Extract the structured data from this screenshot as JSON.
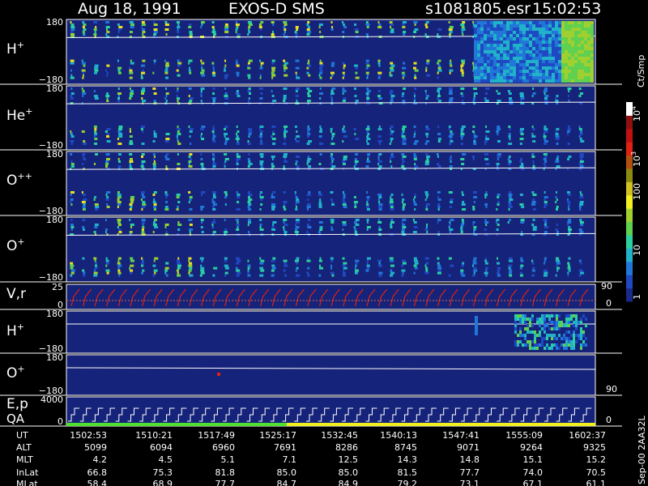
{
  "header": {
    "date": "Aug 18, 1991",
    "instrument": "EXOS-D SMS",
    "file": "s1081805.esr",
    "time": "15:02:53"
  },
  "colorbar": {
    "unit_label": "Ct/Smp",
    "tick_labels": [
      "1",
      "10",
      "100",
      "10",
      "3",
      "10",
      "4"
    ],
    "colors": [
      "#1a2a8a",
      "#1f49c2",
      "#2077d8",
      "#20b2c8",
      "#2ad0a0",
      "#5fd050",
      "#a0d030",
      "#f0f020",
      "#d0c020",
      "#8a8a10",
      "#b05010",
      "#e02010",
      "#c01010",
      "#901010",
      "#ffffff"
    ]
  },
  "panels": [
    {
      "id": "hplus",
      "label": "H",
      "sup": "+",
      "ymax": "180",
      "ymin": "−180"
    },
    {
      "id": "heplus",
      "label": "He",
      "sup": "+",
      "ymax": "180",
      "ymin": "−180"
    },
    {
      "id": "oplusplus",
      "label": "O",
      "sup": "++",
      "ymax": "180",
      "ymin": "−180"
    },
    {
      "id": "oplus",
      "label": "O",
      "sup": "+",
      "ymax": "180",
      "ymin": "−180"
    },
    {
      "id": "vr",
      "label": "V,r",
      "ymax": "25",
      "ymin": "0",
      "right_max": "90",
      "right_min": "0"
    },
    {
      "id": "hplus2",
      "label": "H",
      "sup": "+",
      "ymax": "180",
      "ymin": "−180"
    },
    {
      "id": "oplus2",
      "label": "O",
      "sup": "+",
      "ymax": "180",
      "ymin": "−180",
      "right_min": "90"
    },
    {
      "id": "ep",
      "label": "E,p",
      "label2": "QA",
      "ymax": "4000",
      "ymin": "0",
      "right_min": "0"
    }
  ],
  "side_label": "Sep-00  2AA32L",
  "chart_data": {
    "type": "table",
    "rows": [
      {
        "name": "UT",
        "values": [
          "1502:53",
          "1510:21",
          "1517:49",
          "1525:17",
          "1532:45",
          "1540:13",
          "1547:41",
          "1555:09",
          "1602:37"
        ]
      },
      {
        "name": "ALT",
        "values": [
          "5099",
          "6094",
          "6960",
          "7691",
          "8286",
          "8745",
          "9071",
          "9264",
          "9325"
        ]
      },
      {
        "name": "MLT",
        "values": [
          "4.2",
          "4.5",
          "5.1",
          "7.1",
          "12.5",
          "14.3",
          "14.8",
          "15.1",
          "15.2"
        ]
      },
      {
        "name": "InLat",
        "values": [
          "66.8",
          "75.3",
          "81.8",
          "85.0",
          "85.0",
          "81.5",
          "77.7",
          "74.0",
          "70.5"
        ]
      },
      {
        "name": "MLat",
        "values": [
          "58.4",
          "68.9",
          "77.7",
          "84.7",
          "84.9",
          "79.2",
          "73.1",
          "67.1",
          "61.1"
        ]
      }
    ]
  }
}
